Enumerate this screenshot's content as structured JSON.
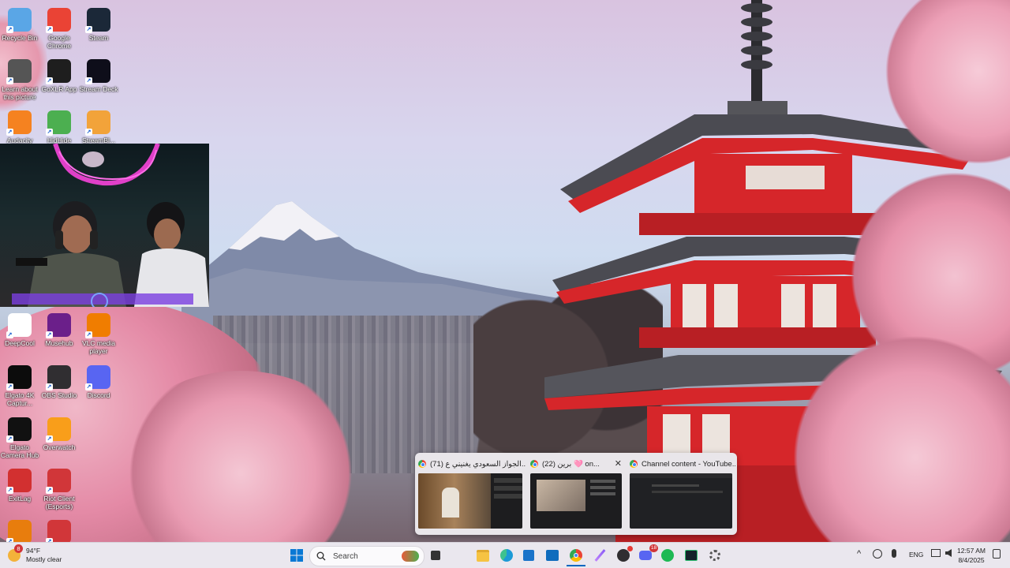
{
  "desktop": {
    "icons": [
      {
        "label": "Recycle Bin",
        "icon": "recycle-bin-icon",
        "color": "#5aa6e6"
      },
      {
        "label": "Google Chrome",
        "icon": "chrome-icon",
        "color": "#ea4335"
      },
      {
        "label": "Steam",
        "icon": "steam-icon",
        "color": "#1b2838"
      },
      {
        "label": "Learn about this picture",
        "icon": "camera-icon",
        "color": "#555555"
      },
      {
        "label": "GoXLR App",
        "icon": "goxlr-icon",
        "color": "#1e1e1e"
      },
      {
        "label": "Stream Deck",
        "icon": "stream-deck-icon",
        "color": "#0e0e1a"
      },
      {
        "label": "Audacity",
        "icon": "audacity-icon",
        "color": "#f58220"
      },
      {
        "label": "HidHide",
        "icon": "hidhide-icon",
        "color": "#4caf50"
      },
      {
        "label": "StreamBl...",
        "icon": "streambl-icon",
        "color": "#f2a33a"
      },
      {
        "label": "DeepCool",
        "icon": "deepcool-icon",
        "color": "#ffffff"
      },
      {
        "label": "Musehub",
        "icon": "musehub-icon",
        "color": "#6b1f8a"
      },
      {
        "label": "VLC media player",
        "icon": "vlc-icon",
        "color": "#f07d00"
      },
      {
        "label": "Elgato 4K Captur...",
        "icon": "elgato-4k-icon",
        "color": "#0c0c0c"
      },
      {
        "label": "OBS Studio",
        "icon": "obs-icon",
        "color": "#302e31"
      },
      {
        "label": "Discord",
        "icon": "discord-icon",
        "color": "#5865f2"
      },
      {
        "label": "Elgato Camera Hub",
        "icon": "elgato-camera-icon",
        "color": "#111111"
      },
      {
        "label": "Overwatch",
        "icon": "overwatch-icon",
        "color": "#f99e1a"
      },
      {
        "label": "ExitLag",
        "icon": "exitlag-icon",
        "color": "#d23030"
      },
      {
        "label": "Riot Client (Esports)",
        "icon": "riot-client-icon",
        "color": "#d13639"
      },
      {
        "label": "",
        "icon": "blender-icon",
        "color": "#e87d0d"
      },
      {
        "label": "",
        "icon": "riot-client-icon",
        "color": "#d13639"
      }
    ]
  },
  "taskbar_previews": [
    {
      "title": "(71) الجواز السعودي يغنيني ع...",
      "icon": "chrome-icon"
    },
    {
      "title": "(22) برين 🩷 on...",
      "icon": "chrome-icon"
    },
    {
      "title": "Channel content - YouTube...",
      "icon": "chrome-icon"
    }
  ],
  "preview_close_glyph": "✕",
  "taskbar": {
    "weather": {
      "badge": "8",
      "temp": "94°F",
      "condition": "Mostly clear"
    },
    "search_placeholder": "Search",
    "language": "ENG",
    "time": "12:57 AM",
    "date": "8/4/2025",
    "apps": [
      "start-icon",
      "search-icon",
      "widget-icon",
      "task-view-icon",
      "file-explorer-icon",
      "edge-icon",
      "store-icon",
      "outlook-icon",
      "chrome-icon",
      "pen-icon",
      "obs-icon",
      "discord-icon",
      "spotify-icon",
      "goxlr-icon",
      "settings-icon"
    ],
    "discord_badge": "18"
  },
  "colors": {
    "taskbar": "#eae7ee",
    "accent": "#0067c0",
    "pagoda_red": "#d6262a"
  }
}
